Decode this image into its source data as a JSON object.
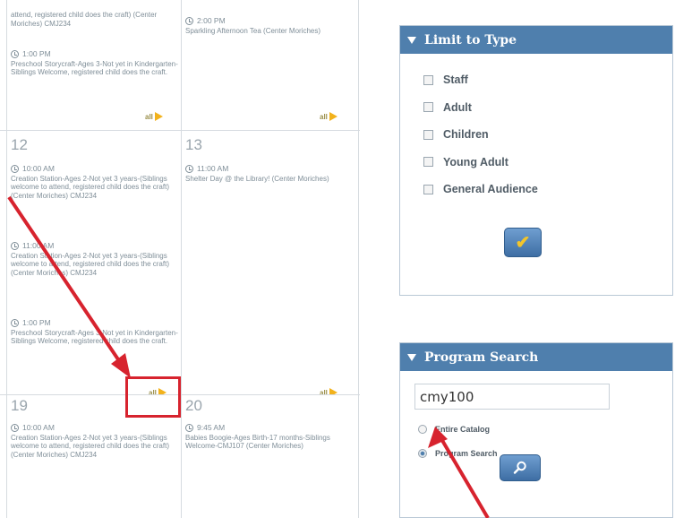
{
  "calendar": {
    "week1": {
      "col1": {
        "event_a": {
          "text": "attend, registered child does the craft) (Center Moriches) CMJ234"
        },
        "event_b": {
          "time": "1:00 PM",
          "text": "Preschool Storycraft-Ages 3-Not yet in Kindergarten-Siblings Welcome, registered child does the craft."
        },
        "all_label": "all"
      },
      "col2": {
        "event_a": {
          "time": "2:00 PM",
          "text": "Sparkling Afternoon Tea (Center Moriches)"
        },
        "all_label": "all"
      }
    },
    "week2": {
      "col1": {
        "day": "12",
        "events": [
          {
            "time": "10:00 AM",
            "text": "Creation Station-Ages 2-Not yet 3 years-(Siblings welcome to attend, registered child does the craft) (Center Moriches) CMJ234"
          },
          {
            "time": "11:00 AM",
            "text": "Creation Station-Ages 2-Not yet 3 years-(Siblings welcome to attend, registered child does the craft) (Center Moriches) CMJ234"
          },
          {
            "time": "1:00 PM",
            "text": "Preschool Storycraft-Ages 3-Not yet in Kindergarten-Siblings Welcome, registered child does the craft."
          }
        ],
        "all_label": "all"
      },
      "col2": {
        "day": "13",
        "events": [
          {
            "time": "11:00 AM",
            "text": "Shelter Day @ the Library! (Center Moriches)"
          }
        ],
        "all_label": "all"
      }
    },
    "week3": {
      "col1": {
        "day": "19",
        "events": [
          {
            "time": "10:00 AM",
            "text": "Creation Station-Ages 2-Not yet 3 years-(Siblings welcome to attend, registered child does the craft) (Center Moriches) CMJ234"
          }
        ]
      },
      "col2": {
        "day": "20",
        "events": [
          {
            "time": "9:45 AM",
            "text": "Babies Boogie-Ages Birth-17 months-Siblings Welcome-CMJ107 (Center Moriches)"
          }
        ]
      }
    }
  },
  "limit_to_type": {
    "title": "Limit to Type",
    "options": [
      "Staff",
      "Adult",
      "Children",
      "Young Adult",
      "General Audience"
    ],
    "apply_icon": "checkmark-icon"
  },
  "program_search": {
    "title": "Program Search",
    "input_value": "cmy100",
    "radios": [
      {
        "label": "Entire Catalog",
        "selected": false
      },
      {
        "label": "Program Search",
        "selected": true
      }
    ],
    "search_icon": "magnifier-icon"
  },
  "colors": {
    "panel_header": "#4f7fad",
    "annotation_red": "#d7232e",
    "all_arrow": "#f2b21c"
  }
}
